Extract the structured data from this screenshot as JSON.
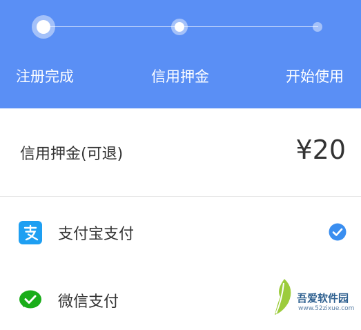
{
  "steps": [
    {
      "label": "注册完成",
      "state": "done"
    },
    {
      "label": "信用押金",
      "state": "current"
    },
    {
      "label": "开始使用",
      "state": "pending"
    }
  ],
  "deposit": {
    "label": "信用押金(可退)",
    "amount": "¥20"
  },
  "payment_methods": [
    {
      "label": "支付宝支付",
      "icon": "alipay-icon",
      "selected": true
    },
    {
      "label": "微信支付",
      "icon": "wechat-pay-icon",
      "selected": false
    }
  ],
  "watermark": {
    "title": "吾爱软件园",
    "site": "www.52zixue.com"
  },
  "colors": {
    "header": "#5a8ff5",
    "alipay": "#1e9ff2",
    "wechat": "#1aad19",
    "check": "#3a8ef0"
  }
}
